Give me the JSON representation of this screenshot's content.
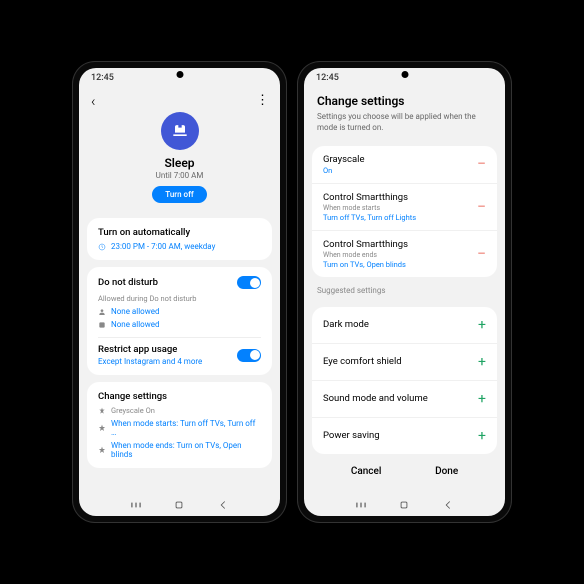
{
  "left": {
    "time": "12:45",
    "hero": {
      "title": "Sleep",
      "subtitle": "Until 7:00 AM",
      "button": "Turn off"
    },
    "auto": {
      "title": "Turn on automatically",
      "schedule": "23:00 PM - 7:00 AM, weekday"
    },
    "dnd": {
      "title": "Do not disturb",
      "allowed_label": "Allowed during Do not disturb",
      "line1": "None allowed",
      "line2": "None allowed"
    },
    "restrict": {
      "title": "Restrict app usage",
      "detail": "Except Instagram and 4 more"
    },
    "change": {
      "title": "Change settings",
      "l1": "Greyscale On",
      "l2": "When mode starts: Turn off TVs, Turn off …",
      "l3": "When mode ends: Turn on TVs, Open blinds"
    }
  },
  "right": {
    "time": "12:45",
    "title": "Change settings",
    "desc": "Settings you choose will be applied when the mode is turned on.",
    "active": [
      {
        "title": "Grayscale",
        "sub1": "",
        "sub2": "On"
      },
      {
        "title": "Control Smartthings",
        "sub1": "When mode starts",
        "sub2": "Turn off TVs, Turn off Lights"
      },
      {
        "title": "Control Smartthings",
        "sub1": "When mode ends",
        "sub2": "Turn on TVs, Open blinds"
      }
    ],
    "suggested_label": "Suggested settings",
    "suggested": [
      {
        "title": "Dark mode"
      },
      {
        "title": "Eye comfort shield"
      },
      {
        "title": "Sound mode and volume"
      },
      {
        "title": "Power saving"
      }
    ],
    "cancel": "Cancel",
    "done": "Done"
  }
}
